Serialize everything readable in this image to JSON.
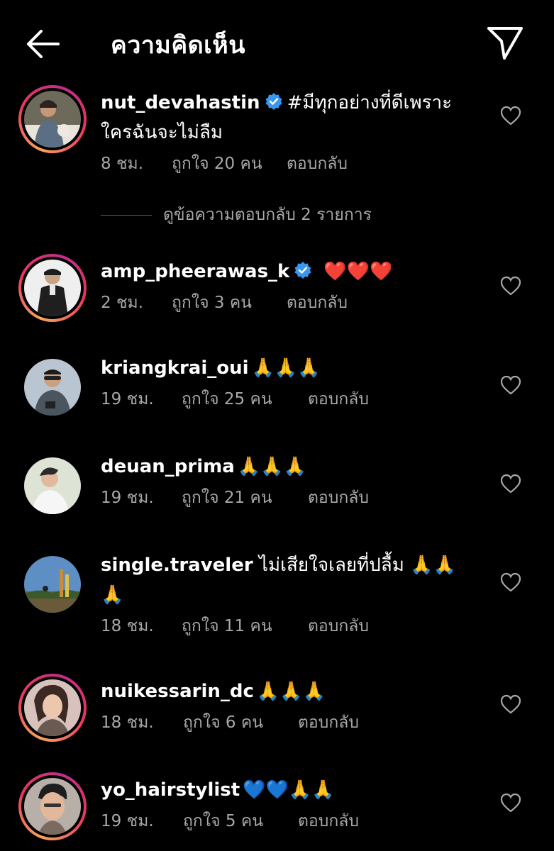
{
  "header": {
    "title": "ความคิดเห็น",
    "back_icon": "arrow-left-icon",
    "share_icon": "paper-plane-icon"
  },
  "view_replies": "ดูข้อความตอบกลับ 2 รายการ",
  "comments": [
    {
      "username": "nut_devahastin",
      "verified": true,
      "text": "#มีทุกอย่างที่ดีเพราะใครฉันจะไม่ลืม",
      "text_line1": "#มีทุกอย่างที่ดีเพราะ",
      "text_line2": "ใครฉันจะไม่ลืม",
      "time": "8 ชม.",
      "likes": "ถูกใจ 20 คน",
      "reply": "ตอบกลับ",
      "story_ring": true
    },
    {
      "username": "amp_pheerawas_k",
      "verified": true,
      "text": "❤️❤️❤️",
      "time": "2 ชม.",
      "likes": "ถูกใจ 3 คน",
      "reply": "ตอบกลับ",
      "story_ring": true
    },
    {
      "username": "kriangkrai_oui",
      "verified": false,
      "text": "🙏🙏🙏",
      "time": "19 ชม.",
      "likes": "ถูกใจ 25 คน",
      "reply": "ตอบกลับ",
      "story_ring": false
    },
    {
      "username": "deuan_prima",
      "verified": false,
      "text": "🙏🙏🙏",
      "time": "19 ชม.",
      "likes": "ถูกใจ 21 คน",
      "reply": "ตอบกลับ",
      "story_ring": false
    },
    {
      "username": "single.traveler",
      "verified": false,
      "text": "ไม่เสียใจเลยที่ปลื้ม 🙏🙏🙏",
      "text_line1": "ไม่เสียใจเลยที่ปลื้ม",
      "time": "18 ชม.",
      "likes": "ถูกใจ 11 คน",
      "reply": "ตอบกลับ",
      "story_ring": false
    },
    {
      "username": "nuikessarin_dc",
      "verified": false,
      "text": "🙏🙏🙏",
      "time": "18 ชม.",
      "likes": "ถูกใจ 6 คน",
      "reply": "ตอบกลับ",
      "story_ring": true
    },
    {
      "username": "yo_hairstylist",
      "verified": false,
      "text": "💙💙🙏🙏",
      "time": "19 ชม.",
      "likes": "ถูกใจ 5 คน",
      "reply": "ตอบกลับ",
      "story_ring": true
    }
  ],
  "colors": {
    "background": "#000000",
    "text": "#ffffff",
    "secondary_text": "#a8a8a8",
    "verified_badge": "#3897f0",
    "story_ring_start": "#f9a35b",
    "story_ring_end": "#c42d8b"
  }
}
